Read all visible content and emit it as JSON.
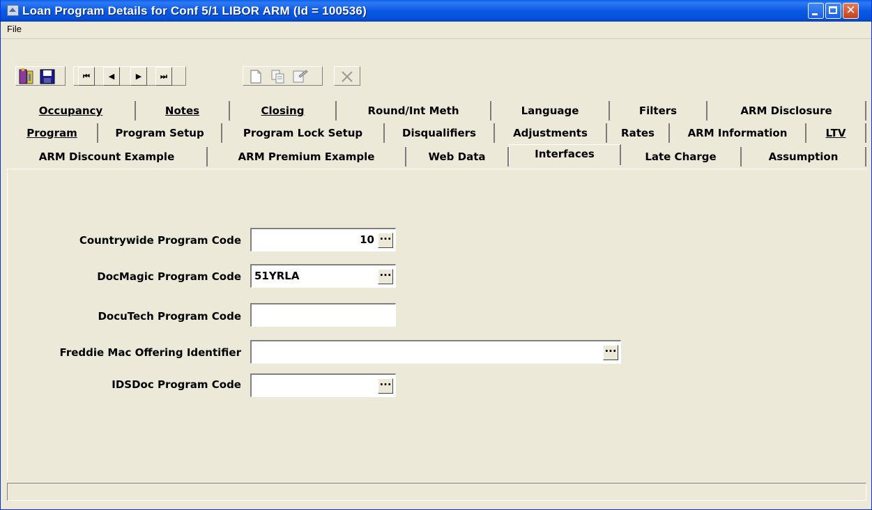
{
  "window": {
    "title": "Loan Program Details for Conf 5/1 LIBOR ARM (Id = 100536)"
  },
  "menu": {
    "file": "File"
  },
  "toolbar": {
    "exit_icon": "exit-door-icon",
    "save_icon": "floppy-disk-icon",
    "first_icon": "first-record-icon",
    "prev_icon": "previous-record-icon",
    "next_icon": "next-record-icon",
    "last_icon": "last-record-icon",
    "new_icon": "new-document-icon",
    "copy_icon": "copy-icon",
    "properties_icon": "properties-icon",
    "delete_icon": "delete-x-icon",
    "first_glyph": "⏮",
    "prev_glyph": "◀",
    "next_glyph": "▶",
    "last_glyph": "⏭"
  },
  "tabs": {
    "row1": [
      "Occupancy",
      "Notes",
      "Closing",
      "Round/Int Meth",
      "Language",
      "Filters",
      "ARM Disclosure"
    ],
    "row2": [
      "Program",
      "Program Setup",
      "Program Lock Setup",
      "Disqualifiers",
      "Adjustments",
      "Rates",
      "ARM Information",
      "LTV"
    ],
    "row3": [
      "ARM Discount Example",
      "ARM Premium Example",
      "Web Data",
      "Interfaces",
      "Late Charge",
      "Assumption"
    ],
    "active": "Interfaces"
  },
  "form": {
    "countrywide": {
      "label": "Countrywide Program Code",
      "value": "10"
    },
    "docmagic": {
      "label": "DocMagic Program Code",
      "value": "51YRLA"
    },
    "docutech": {
      "label": "DocuTech Program Code",
      "value": ""
    },
    "freddie": {
      "label": "Freddie Mac Offering Identifier",
      "value": ""
    },
    "idsdoc": {
      "label": "IDSDoc Program Code",
      "value": ""
    },
    "ellipsis": "..."
  },
  "status": {
    "text": ""
  },
  "colors": {
    "titlebar": "#0a5ee8",
    "window_bg": "#ece9d8",
    "close_button": "#c8401d"
  }
}
